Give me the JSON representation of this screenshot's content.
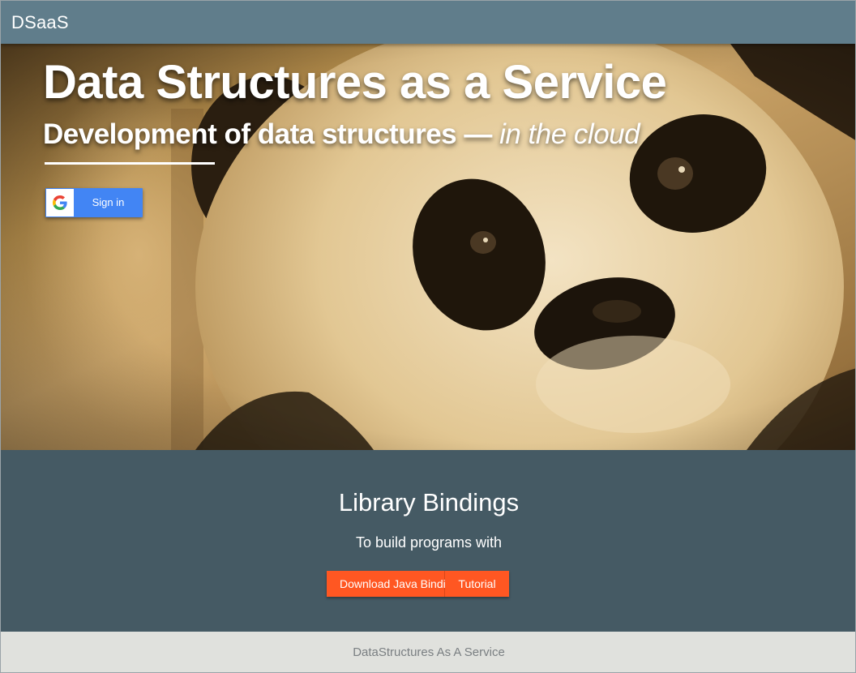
{
  "appbar": {
    "brand": "DSaaS"
  },
  "hero": {
    "title": "Data Structures as a Service",
    "subtitle_prefix": "Development of data structures — ",
    "subtitle_emphasis": "in the cloud",
    "signin": {
      "label": "Sign in",
      "icon": "google-g-icon"
    },
    "background": "panda-photo"
  },
  "bindings": {
    "heading": "Library Bindings",
    "subheading": "To build programs with",
    "buttons": {
      "download_label": "Download Java Binding",
      "tutorial_label": "Tutorial"
    }
  },
  "footer": {
    "text": "DataStructures As A Service"
  },
  "colors": {
    "appbar": "#607d8b",
    "bindings_bg": "#455a64",
    "accent": "#ff5722",
    "google_blue": "#4285f4",
    "footer_bg": "#e0e1dd"
  }
}
